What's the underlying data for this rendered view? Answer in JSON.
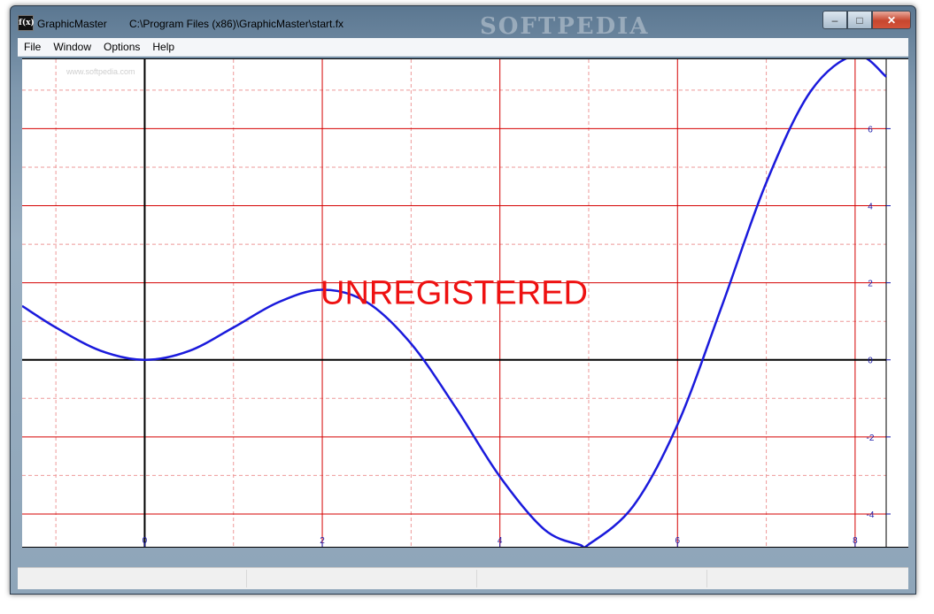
{
  "window": {
    "app_name": "GraphicMaster",
    "file_path": "C:\\Program Files (x86)\\GraphicMaster\\start.fx",
    "icon_label": "f(x)",
    "watermark": "SOFTPEDIA",
    "sub_watermark": "www.softpedia.com"
  },
  "caption_buttons": {
    "minimize": "–",
    "maximize": "□",
    "close": "✕"
  },
  "menu": [
    "File",
    "Window",
    "Options",
    "Help"
  ],
  "overlay_text": "UNREGISTERED",
  "colors": {
    "curve": "#1a1adc",
    "major_grid": "#d40000",
    "minor_grid": "#ee9999",
    "axis": "#000000",
    "tick_label": "#1a1aa8",
    "overlay": "#ee1111"
  },
  "chart_data": {
    "type": "line",
    "title": "",
    "xlabel": "",
    "ylabel": "",
    "xlim": [
      -1.38,
      8.35
    ],
    "ylim": [
      -4.85,
      7.8
    ],
    "x_ticks": [
      0,
      2,
      4,
      6,
      8
    ],
    "y_ticks": [
      -4,
      -2,
      0,
      2,
      4,
      6
    ],
    "x_tick_labels": [
      "0",
      "2",
      "4",
      "6",
      "8"
    ],
    "y_tick_labels": [
      "-4",
      "-2",
      "0",
      "2",
      "4",
      "6"
    ],
    "major_grid_x": [
      0,
      2,
      4,
      6,
      8
    ],
    "minor_grid_x": [
      -1,
      1,
      3,
      5,
      7
    ],
    "major_grid_y": [
      -4,
      -2,
      2,
      4,
      6
    ],
    "minor_grid_y": [
      -3,
      -1,
      1,
      3,
      5,
      7
    ],
    "grid": true,
    "series": [
      {
        "values": [
          [
            -1.38,
            1.4
          ],
          [
            -1.0,
            0.84
          ],
          [
            -0.5,
            0.24
          ],
          [
            0.0,
            0.0
          ],
          [
            0.5,
            0.23
          ],
          [
            1.0,
            0.84
          ],
          [
            1.5,
            1.49
          ],
          [
            2.0,
            1.82
          ],
          [
            2.5,
            1.5
          ],
          [
            3.0,
            0.42
          ],
          [
            3.5,
            -1.23
          ],
          [
            4.0,
            -3.03
          ],
          [
            4.5,
            -4.4
          ],
          [
            4.9,
            -4.8
          ],
          [
            5.0,
            -4.79
          ],
          [
            5.5,
            -3.8
          ],
          [
            6.0,
            -1.68
          ],
          [
            6.5,
            1.4
          ],
          [
            7.0,
            4.6
          ],
          [
            7.5,
            6.97
          ],
          [
            8.0,
            7.9
          ],
          [
            8.35,
            7.35
          ]
        ]
      }
    ]
  }
}
